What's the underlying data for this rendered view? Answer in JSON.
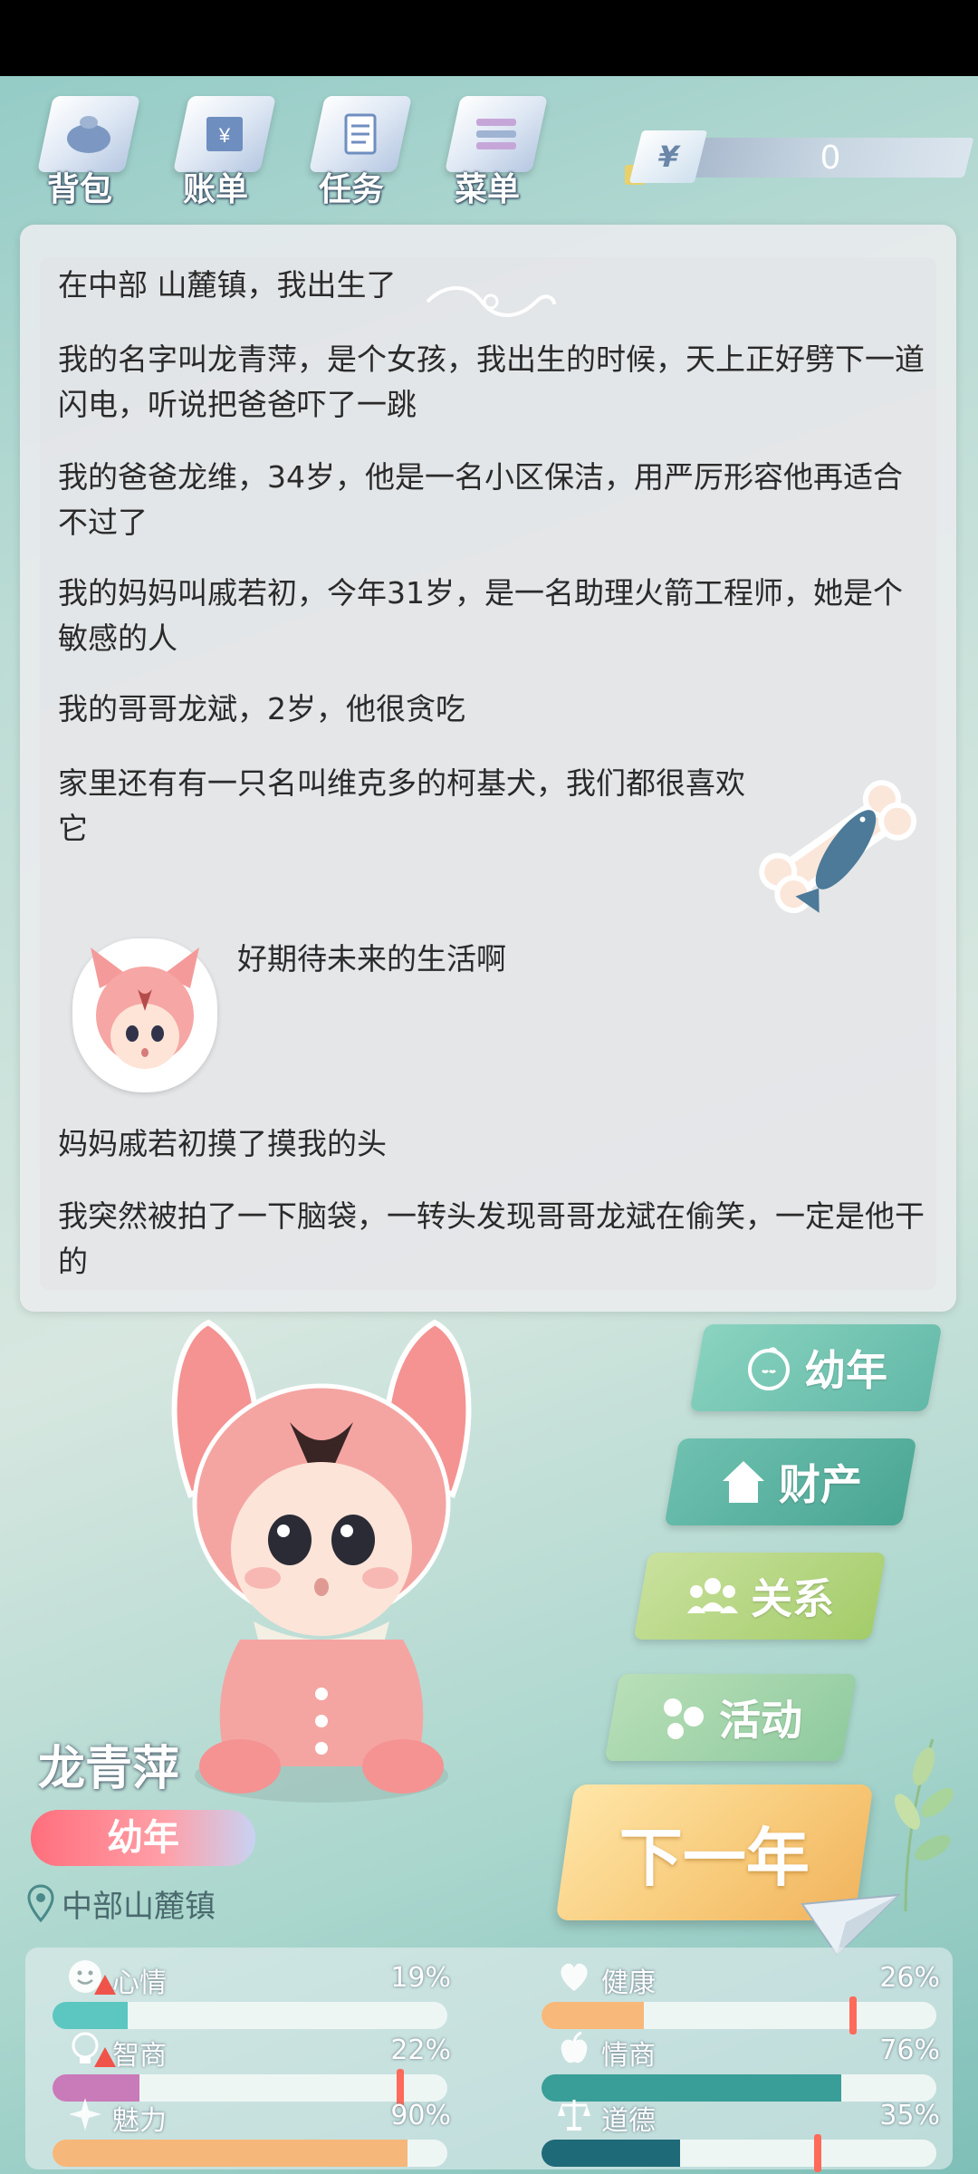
{
  "nav": {
    "items": [
      {
        "label": "背包",
        "icon": "bag-icon"
      },
      {
        "label": "账单",
        "icon": "bill-icon"
      },
      {
        "label": "任务",
        "icon": "task-icon"
      },
      {
        "label": "菜单",
        "icon": "menu-icon"
      }
    ],
    "money": {
      "symbol": "¥",
      "amount": "0"
    }
  },
  "story": {
    "lines": [
      "在中部 山麓镇，我出生了",
      "我的名字叫龙青萍，是个女孩，我出生的时候，天上正好劈下一道闪电，听说把爸爸吓了一跳",
      "我的爸爸龙维，34岁，他是一名小区保洁，用严厉形容他再适合不过了",
      "我的妈妈叫戚若初，今年31岁，是一名助理火箭工程师，她是个敏感的人",
      "我的哥哥龙斌，2岁，他很贪吃",
      "家里还有有一只名叫维克多的柯基犬，我们都很喜欢它",
      "好期待未来的生活啊",
      "妈妈戚若初摸了摸我的头",
      "我突然被拍了一下脑袋，一转头发现哥哥龙斌在偷笑，一定是他干的"
    ]
  },
  "character": {
    "name": "龙青萍",
    "stage": "幼年",
    "location": "中部山麓镇"
  },
  "actions": {
    "stage": "幼年",
    "assets": "财产",
    "relation": "关系",
    "activity": "活动",
    "next_year": "下一年"
  },
  "stats": [
    {
      "name": "心情",
      "pct": "19%",
      "value": 0.19,
      "color": "#5cc6c0",
      "warn": true
    },
    {
      "name": "健康",
      "pct": "26%",
      "value": 0.26,
      "color": "#f8b87a",
      "marker": 0.79
    },
    {
      "name": "智商",
      "pct": "22%",
      "value": 0.22,
      "color": "#c97ab8",
      "warn": true,
      "marker": 0.88
    },
    {
      "name": "情商",
      "pct": "76%",
      "value": 0.76,
      "color": "#3a9e98"
    },
    {
      "name": "魅力",
      "pct": "90%",
      "value": 0.9,
      "color": "#f6b77a"
    },
    {
      "name": "道德",
      "pct": "35%",
      "value": 0.35,
      "color": "#1f6a78",
      "marker": 0.7
    }
  ]
}
